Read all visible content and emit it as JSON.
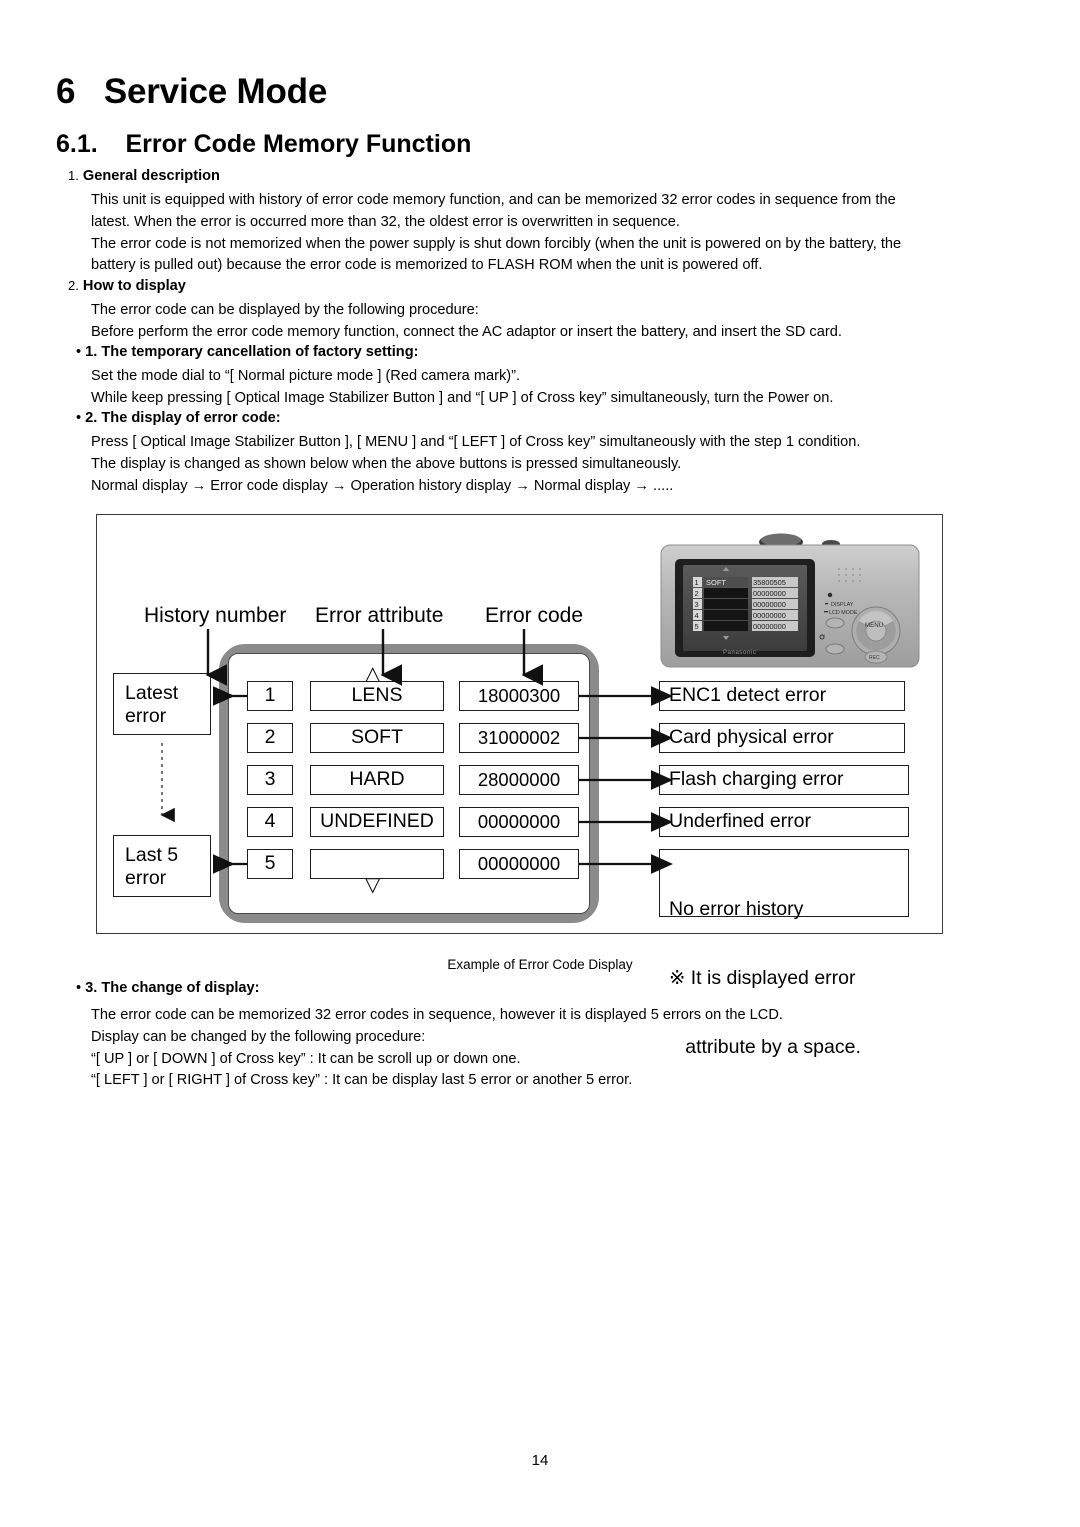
{
  "document": {
    "chapter_number": "6",
    "chapter_title": "Service Mode",
    "section_number": "6.1.",
    "section_title": "Error Code Memory Function",
    "page_number": "14"
  },
  "sections": {
    "general": {
      "index": "1.",
      "heading": "General description",
      "lines": [
        "This unit is equipped with history of error code memory function, and can be memorized 32 error codes in sequence from the",
        "latest. When the error is occurred more than 32, the oldest error is overwritten in sequence.",
        "The error code is not memorized when the power supply is shut down forcibly (when the unit is powered on by the battery, the",
        "battery is pulled out) because the error code is memorized to FLASH ROM when the unit is powered off."
      ]
    },
    "how_to_display": {
      "index": "2.",
      "heading": "How to display",
      "lines": [
        "The error code can be displayed by the following procedure:",
        "Before perform the error code memory function, connect the AC adaptor or insert the battery, and insert the SD card."
      ]
    },
    "step1": {
      "bullet": "•",
      "heading": "1. The temporary cancellation of factory setting:",
      "lines": [
        "Set the mode dial to “[ Normal picture mode ] (Red camera mark)”.",
        "While keep pressing [ Optical Image Stabilizer Button ] and “[ UP ] of Cross key” simultaneously, turn the Power on."
      ]
    },
    "step2": {
      "bullet": "•",
      "heading": "2. The display of error code:",
      "lines": [
        "Press [ Optical Image Stabilizer Button ], [ MENU ] and “[ LEFT ] of Cross key” simultaneously with the step 1 condition.",
        "The display is changed as shown below when the above buttons is pressed simultaneously.",
        "Normal display → Error code display → Operation history display → Normal display → ....."
      ]
    },
    "step3": {
      "bullet": "•",
      "heading": "3. The change of display:",
      "lines": [
        "The error code can be memorized 32 error codes in sequence, however it is displayed 5 errors on the LCD.",
        "Display can be changed by the following procedure:",
        "“[ UP ] or [ DOWN ] of Cross key” : It can be scroll up or down one.",
        "“[ LEFT ] or [ RIGHT ] of Cross key” : It can be display last 5 error or another 5 error."
      ]
    }
  },
  "figure": {
    "caption": "Example of Error Code Display",
    "column_labels": {
      "history_number": "History number",
      "error_attribute": "Error attribute",
      "error_code": "Error code"
    },
    "side_labels": {
      "latest": "Latest\nerror",
      "last5": "Last 5\nerror"
    },
    "scroll_markers": {
      "up": "△",
      "down": "▽"
    },
    "rows": [
      {
        "no": "1",
        "attribute": "LENS",
        "code": "18000300",
        "description": "ENC1 detect error"
      },
      {
        "no": "2",
        "attribute": "SOFT",
        "code": "31000002",
        "description": "Card physical error"
      },
      {
        "no": "3",
        "attribute": "HARD",
        "code": "28000000",
        "description": "Flash charging error"
      },
      {
        "no": "4",
        "attribute": "UNDEFINED",
        "code": "00000000",
        "description": "Underfined error"
      },
      {
        "no": "5",
        "attribute": "",
        "code": "00000000",
        "description": "No error history"
      }
    ],
    "note_box": {
      "line1": "No error history",
      "line2": "※ It is displayed error",
      "line3": "   attribute by a space."
    },
    "camera": {
      "brand": "Panasonic",
      "lcd_rows": [
        {
          "no": "1",
          "attribute": "SOFT",
          "code": "35800505"
        },
        {
          "no": "2",
          "attribute": "",
          "code": "00000000"
        },
        {
          "no": "3",
          "attribute": "",
          "code": "00000000"
        },
        {
          "no": "4",
          "attribute": "",
          "code": "00000000"
        },
        {
          "no": "5",
          "attribute": "",
          "code": "00000000"
        }
      ],
      "button_labels": {
        "display": "DISPLAY",
        "lcd_mode": "LCD MODE",
        "menu": "MENU"
      }
    }
  },
  "colors": {
    "text": "#000000",
    "frame": "#3a3a3a",
    "bezel_gray": "#8b8b8b",
    "box_border": "#1d1d1d"
  }
}
